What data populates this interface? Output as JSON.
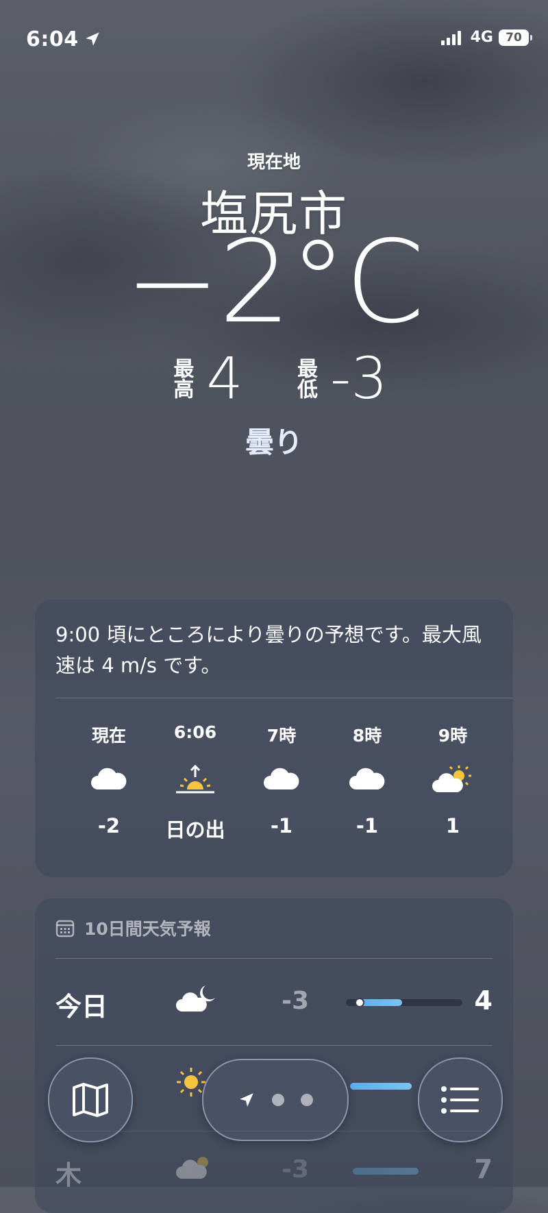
{
  "status_bar": {
    "time": "6:04",
    "network": "4G",
    "battery": "70"
  },
  "header": {
    "location_label": "現在地",
    "city": "塩尻市",
    "temperature": "−2°C",
    "high_label": "最高",
    "high_value": "4",
    "low_label": "最低",
    "low_value": "-3",
    "condition": "曇り"
  },
  "hourly": {
    "summary": "9:00 頃にところにより曇りの予想です。最大風速は 4 m/s です。",
    "items": [
      {
        "label": "現在",
        "icon": "cloud-icon",
        "value": "-2"
      },
      {
        "label": "6:06",
        "icon": "sunrise-icon",
        "value": "日の出"
      },
      {
        "label": "7時",
        "icon": "cloud-icon",
        "value": "-1"
      },
      {
        "label": "8時",
        "icon": "cloud-icon",
        "value": "-1"
      },
      {
        "label": "9時",
        "icon": "partly-sunny-icon",
        "value": "1"
      }
    ]
  },
  "forecast": {
    "title": "10日間天気予報",
    "days": [
      {
        "name": "今日",
        "icon": "cloud-moon-icon",
        "low": "-3",
        "high": "4"
      },
      {
        "name": "",
        "icon": "sun-icon",
        "low": "",
        "high": ""
      },
      {
        "name": "木",
        "icon": "partly-sunny-icon",
        "low": "-3",
        "high": "7"
      }
    ]
  },
  "colors": {
    "accent_bar": "#6ab8ee",
    "sun": "#f5c542"
  }
}
